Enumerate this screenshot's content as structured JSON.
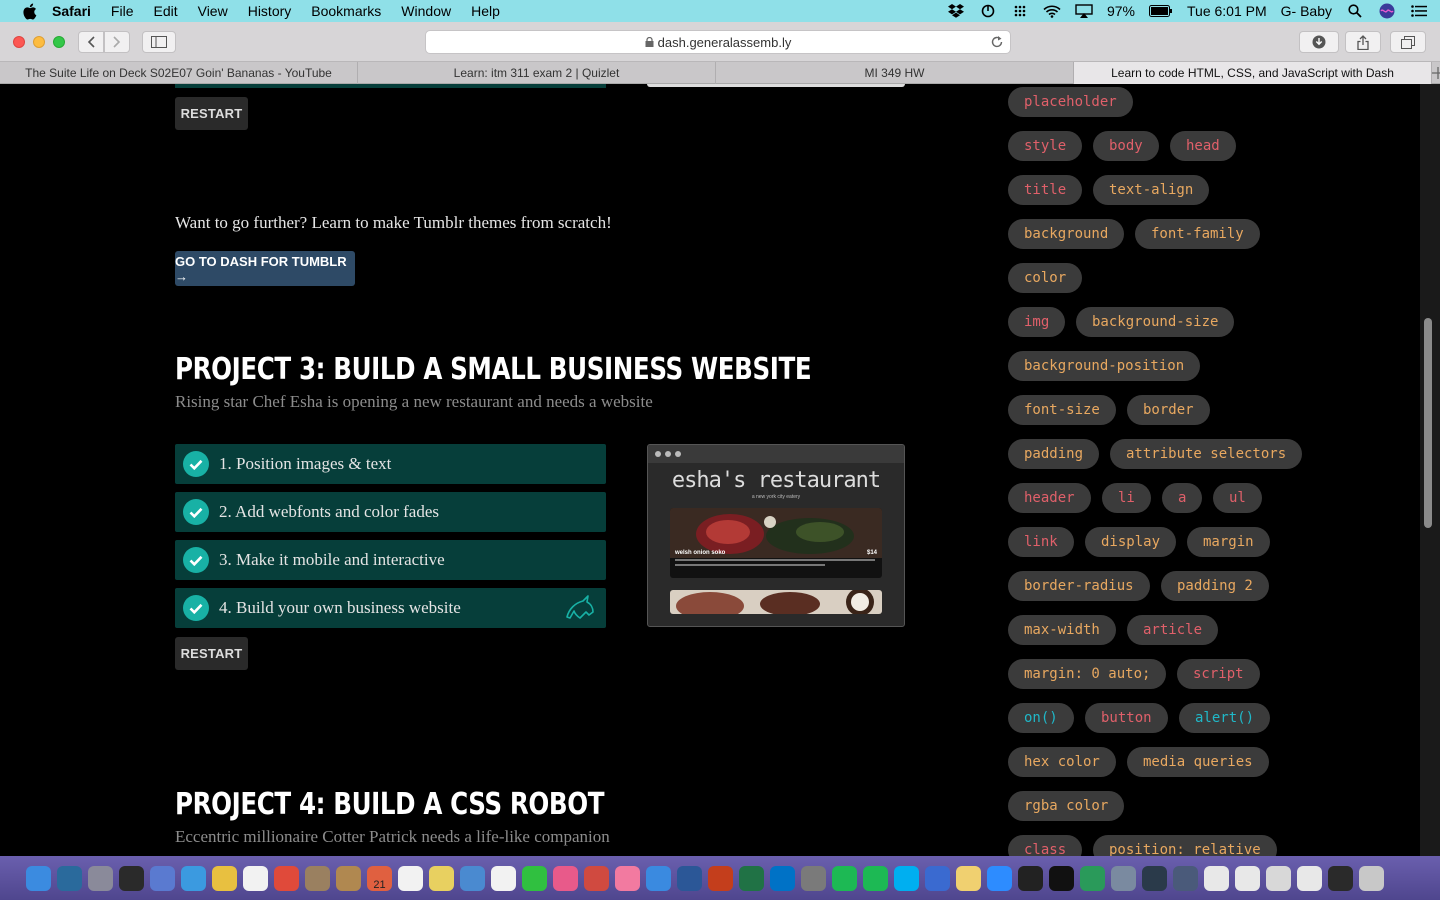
{
  "menubar": {
    "app": "Safari",
    "items": [
      "File",
      "Edit",
      "View",
      "History",
      "Bookmarks",
      "Window",
      "Help"
    ],
    "battery": "97%",
    "clock": "Tue 6:01 PM",
    "user": "G- Baby"
  },
  "browser": {
    "url": "dash.generalassemb.ly",
    "tabs": [
      "The Suite Life on Deck S02E07 Goin' Bananas - YouTube",
      "Learn: itm 311 exam 2 | Quizlet",
      "MI 349 HW",
      "Learn to code HTML, CSS, and JavaScript with Dash"
    ],
    "active_tab": 3
  },
  "main": {
    "restart_top": "RESTART",
    "tumblr_text": "Want to go further? Learn to make Tumblr themes from scratch!",
    "tumblr_button": "GO TO DASH FOR TUMBLR →",
    "project3": {
      "title": "PROJECT 3: BUILD A SMALL BUSINESS WEBSITE",
      "subtitle": "Rising star Chef Esha is opening a new restaurant and needs a website",
      "steps": [
        "1. Position images & text",
        "2. Add webfonts and color fades",
        "3. Make it mobile and interactive",
        "4. Build your own business website"
      ],
      "restart": "RESTART",
      "preview": {
        "title": "esha's restaurant",
        "subtitle": "a new york city eatery",
        "dish": "welsh onion soko",
        "price": "$14"
      }
    },
    "project4": {
      "title": "PROJECT 4: BUILD A CSS ROBOT",
      "subtitle": "Eccentric millionaire Cotter Patrick needs a life-like companion"
    }
  },
  "sidebar": {
    "chips": [
      {
        "label": "placeholder",
        "color": "#e0606a"
      },
      {
        "label": "style",
        "color": "#e0606a"
      },
      {
        "label": "body",
        "color": "#e0606a"
      },
      {
        "label": "head",
        "color": "#e0606a"
      },
      {
        "label": "title",
        "color": "#e0606a"
      },
      {
        "label": "text-align",
        "color": "#e8a860"
      },
      {
        "label": "background",
        "color": "#e8a860"
      },
      {
        "label": "font-family",
        "color": "#e8a860"
      },
      {
        "label": "color",
        "color": "#e8a860"
      },
      {
        "label": "img",
        "color": "#e0606a"
      },
      {
        "label": "background-size",
        "color": "#e8a860"
      },
      {
        "label": "background-position",
        "color": "#e8a860"
      },
      {
        "label": "font-size",
        "color": "#e8a860"
      },
      {
        "label": "border",
        "color": "#e8a860"
      },
      {
        "label": "padding",
        "color": "#e8a860"
      },
      {
        "label": "attribute selectors",
        "color": "#e8a860"
      },
      {
        "label": "header",
        "color": "#e0606a"
      },
      {
        "label": "li",
        "color": "#e0606a"
      },
      {
        "label": "a",
        "color": "#e0606a"
      },
      {
        "label": "ul",
        "color": "#e0606a"
      },
      {
        "label": "link",
        "color": "#e0606a"
      },
      {
        "label": "display",
        "color": "#e8a860"
      },
      {
        "label": "margin",
        "color": "#e8a860"
      },
      {
        "label": "border-radius",
        "color": "#e8a860"
      },
      {
        "label": "padding 2",
        "color": "#e8a860"
      },
      {
        "label": "max-width",
        "color": "#e8a860"
      },
      {
        "label": "article",
        "color": "#e0606a"
      },
      {
        "label": "margin: 0 auto;",
        "color": "#e8a860"
      },
      {
        "label": "script",
        "color": "#e0606a"
      },
      {
        "label": "on()",
        "color": "#20b8c8"
      },
      {
        "label": "button",
        "color": "#e0606a"
      },
      {
        "label": "alert()",
        "color": "#20b8c8"
      },
      {
        "label": "hex color",
        "color": "#e8a860"
      },
      {
        "label": "media queries",
        "color": "#e8a860"
      },
      {
        "label": "rgba color",
        "color": "#e8a860"
      },
      {
        "label": "class",
        "color": "#e0606a"
      },
      {
        "label": "position: relative",
        "color": "#e8a860"
      }
    ]
  },
  "dock": {
    "calendar_day": "21"
  }
}
